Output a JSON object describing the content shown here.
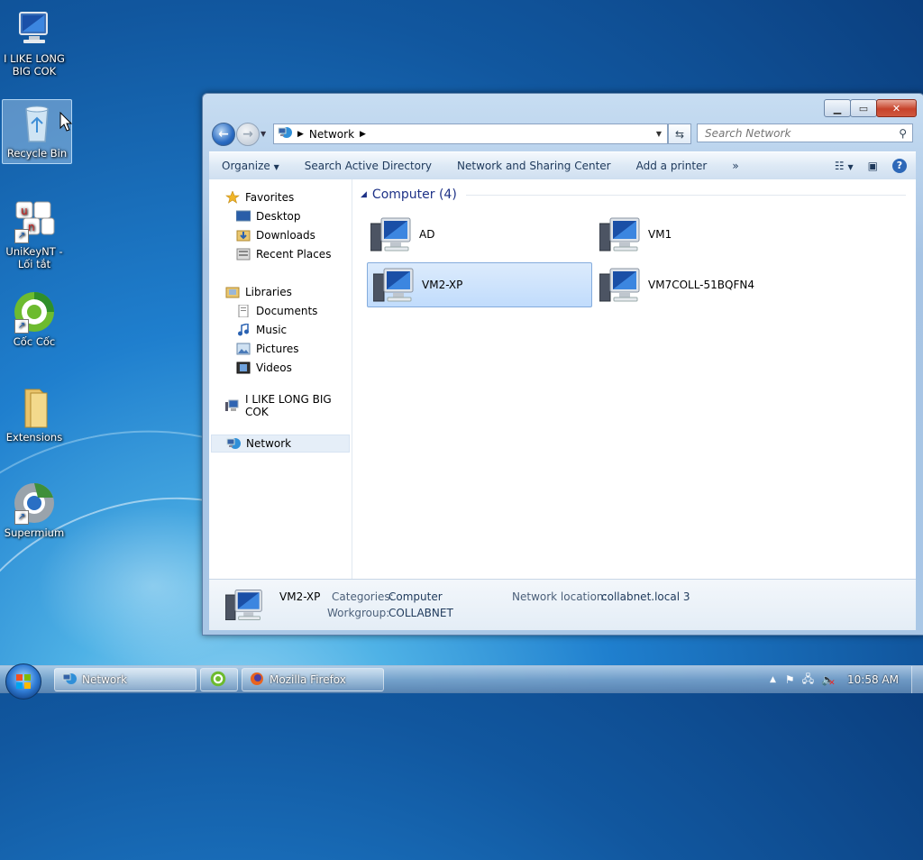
{
  "desktop": {
    "icons": [
      {
        "label": "I LIKE LONG BIG COK",
        "icon": "computer-icon"
      },
      {
        "label": "Recycle Bin",
        "icon": "recycle-bin-icon"
      },
      {
        "label": "UniKeyNT - Lối tắt",
        "icon": "unikey-icon"
      },
      {
        "label": "Cốc Cốc",
        "icon": "coccoc-icon"
      },
      {
        "label": "Extensions",
        "icon": "folder-icon"
      },
      {
        "label": "Supermium",
        "icon": "supermium-icon"
      }
    ]
  },
  "window": {
    "address": {
      "segments": [
        "Network"
      ]
    },
    "search": {
      "placeholder": "Search Network"
    },
    "toolbar": {
      "organize": "Organize",
      "search_ad": "Search Active Directory",
      "network_center": "Network and Sharing Center",
      "add_printer": "Add a printer",
      "more": "»"
    },
    "nav": {
      "favorites": "Favorites",
      "desktop": "Desktop",
      "downloads": "Downloads",
      "recent": "Recent Places",
      "libraries": "Libraries",
      "documents": "Documents",
      "music": "Music",
      "pictures": "Pictures",
      "videos": "Videos",
      "computer": "I LIKE LONG BIG COK",
      "network": "Network"
    },
    "group_header": "Computer (4)",
    "items": [
      "AD",
      "VM1",
      "VM2-XP",
      "VM7COLL-51BQFN4"
    ],
    "selected_item": "VM2-XP",
    "details": {
      "name": "VM2-XP",
      "categories_label": "Categories:",
      "categories_value": "Computer",
      "workgroup_label": "Workgroup:",
      "workgroup_value": "COLLABNET",
      "location_label": "Network location:",
      "location_value": "collabnet.local  3"
    }
  },
  "taskbar": {
    "network_button": "Network",
    "firefox_button": "Mozilla Firefox",
    "clock": "10:58 AM"
  },
  "colors": {
    "desktop_blue": "#1f7fce",
    "selection": "#c1dcfc",
    "group_header": "#1e3287"
  }
}
